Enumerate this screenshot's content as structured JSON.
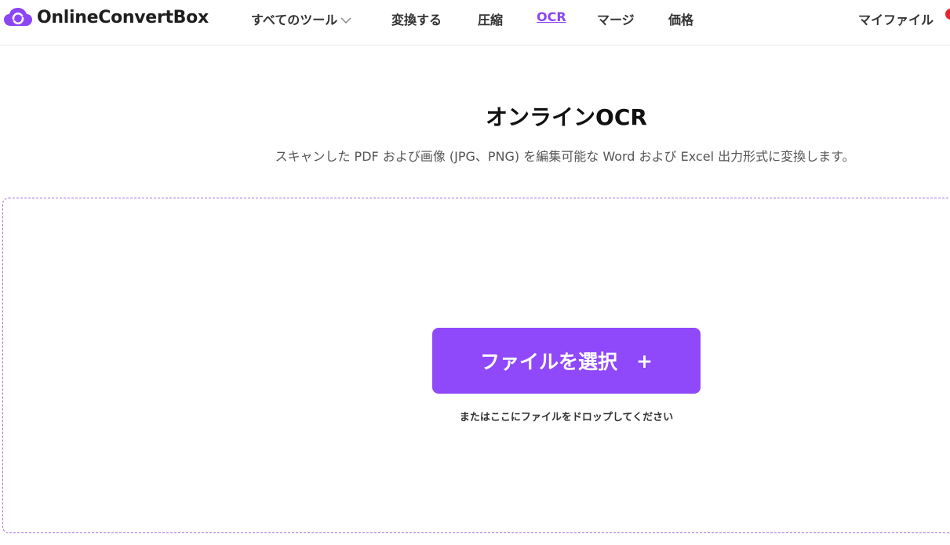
{
  "header": {
    "brand": "OnlineConvertBox",
    "nav": {
      "all_tools": "すべてのツール",
      "convert": "変換する",
      "compress": "圧縮",
      "ocr": "OCR",
      "merge": "マージ",
      "pricing": "価格"
    },
    "my_files": "マイファイル"
  },
  "main": {
    "title": "オンラインOCR",
    "subtitle": "スキャンした PDF および画像 (JPG、PNG) を編集可能な Word および Excel 出力形式に変換します。",
    "select_button_label": "ファイルを選択",
    "select_button_plus": "+",
    "drop_hint": "またはここにファイルをドロップしてください"
  },
  "colors": {
    "accent": "#9048fb",
    "nav_active": "#8b45f5",
    "notification": "#e8252d"
  }
}
